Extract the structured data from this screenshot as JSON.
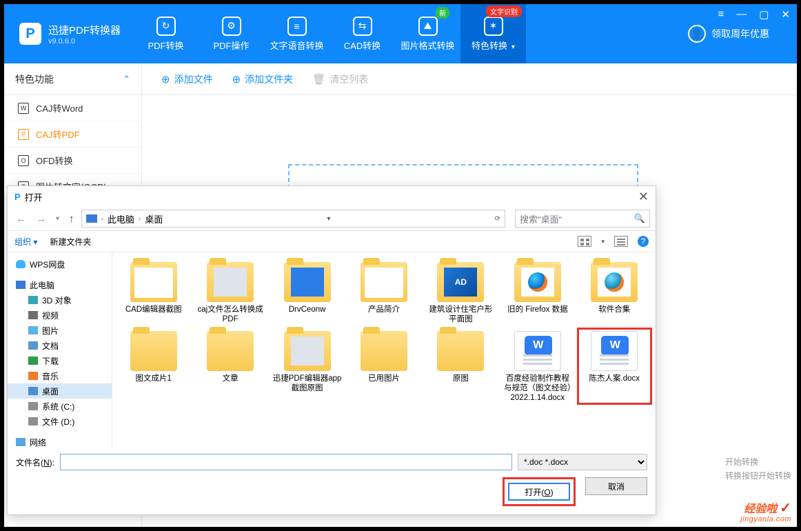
{
  "app": {
    "name": "迅捷PDF转换器",
    "version": "v9.0.6.0"
  },
  "nav": {
    "tabs": [
      {
        "label": "PDF转换",
        "icon": "↻"
      },
      {
        "label": "PDF操作",
        "icon": "⚙"
      },
      {
        "label": "文字语音转换",
        "icon": "≡"
      },
      {
        "label": "CAD转换",
        "icon": "⇆"
      },
      {
        "label": "图片格式转换",
        "icon": "⛰",
        "badge_green": "新"
      },
      {
        "label": "特色转换",
        "icon": "✶",
        "badge_red": "文字识别",
        "active": true,
        "caret": "▾"
      }
    ],
    "vip": "领取周年优惠"
  },
  "toolbar": {
    "side_title": "特色功能",
    "add_file": "添加文件",
    "add_folder": "添加文件夹",
    "clear": "清空列表"
  },
  "sidebar": {
    "items": [
      {
        "label": "CAJ转Word",
        "code": "W"
      },
      {
        "label": "CAJ转PDF",
        "code": "P",
        "active": true
      },
      {
        "label": "OFD转换",
        "code": "O"
      },
      {
        "label": "图片转文字(OCR)",
        "code": "T"
      }
    ]
  },
  "hints": {
    "line1": "开始转换",
    "line2": "转换按钮开始转换"
  },
  "dialog": {
    "title": "打开",
    "breadcrumb": {
      "root": "此电脑",
      "leaf": "桌面"
    },
    "search_placeholder": "搜索\"桌面\"",
    "tools": {
      "organize": "组织",
      "new_folder": "新建文件夹"
    },
    "tree": [
      {
        "label": "WPS网盘",
        "type": "cloud"
      },
      {
        "label": "此电脑",
        "type": "pc"
      },
      {
        "label": "3D 对象",
        "type": "cube",
        "sub": true
      },
      {
        "label": "视频",
        "type": "vid",
        "sub": true
      },
      {
        "label": "图片",
        "type": "img",
        "sub": true
      },
      {
        "label": "文档",
        "type": "doc",
        "sub": true
      },
      {
        "label": "下载",
        "type": "dl",
        "sub": true
      },
      {
        "label": "音乐",
        "type": "music",
        "sub": true
      },
      {
        "label": "桌面",
        "type": "desk",
        "sub": true,
        "selected": true
      },
      {
        "label": "系统 (C:)",
        "type": "drv",
        "sub": true
      },
      {
        "label": "文件 (D:)",
        "type": "drv",
        "sub": true
      },
      {
        "label": "网络",
        "type": "net"
      }
    ],
    "files_row1": [
      {
        "label": "CAD编辑器截图",
        "variant": "open"
      },
      {
        "label": "caj文件怎么转换成PDF",
        "variant": "thumb"
      },
      {
        "label": "DrvCeonw",
        "variant": "blue"
      },
      {
        "label": "产品简介",
        "variant": "open"
      },
      {
        "label": "建筑设计住宅户形平面图",
        "variant": "cad"
      },
      {
        "label": "旧的 Firefox 数据",
        "variant": "ff"
      },
      {
        "label": "软件合集",
        "variant": "ball"
      }
    ],
    "files_row2": [
      {
        "label": "图文成片1",
        "variant": "plain"
      },
      {
        "label": "文章",
        "variant": "plain"
      },
      {
        "label": "迅捷PDF编辑器app截图原图",
        "variant": "thumb"
      },
      {
        "label": "已用图片",
        "variant": "plain"
      },
      {
        "label": "原图",
        "variant": "plain"
      },
      {
        "label": "百度经验制作教程与规范（图文经验）2022.1.14.docx",
        "variant": "docx"
      },
      {
        "label": "陈杰人案.docx",
        "variant": "docx",
        "highlight": true
      }
    ],
    "filename_label_pre": "文件名(",
    "filename_label_u": "N",
    "filename_label_post": "):",
    "filename_value": "",
    "filter": "*.doc *.docx",
    "open_btn_pre": "打开(",
    "open_btn_u": "O",
    "open_btn_post": ")",
    "cancel_btn": "取消"
  },
  "watermark": {
    "line1": "经验啦",
    "check": "✓",
    "line2": "jingyanla.com"
  }
}
